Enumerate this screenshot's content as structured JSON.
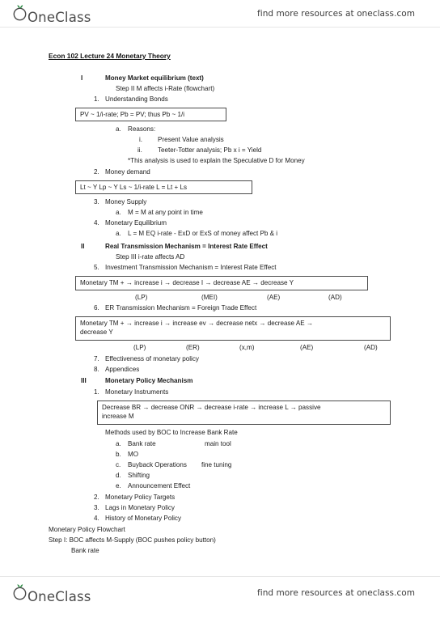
{
  "brand": {
    "logo_text": "OneClass",
    "logo_icon": "sprout-leaf-icon",
    "tagline": "find more resources at oneclass.com",
    "accent_color": "#2e8b46",
    "text_color": "#4a4a4a"
  },
  "document": {
    "title": "Econ 102 Lecture 24 Monetary Theory",
    "sections": [
      {
        "numeral": "I",
        "heading": "Money Market equilibrium (text)",
        "subtitle": "Step II M affects i-Rate (flowchart)",
        "items": [
          {
            "marker": "1.",
            "text": "Understanding Bonds"
          },
          {
            "marker": "a.",
            "text": "Reasons:"
          },
          {
            "marker": "i.",
            "text": "Present Value analysis"
          },
          {
            "marker": "ii.",
            "text": "Teeter-Totter analysis; Pb x i = Yield"
          },
          {
            "marker": "*",
            "text": "*This analysis is used to explain the Speculative D for Money"
          },
          {
            "marker": "2.",
            "text": "Money demand"
          },
          {
            "marker": "3.",
            "text": "Money Supply"
          },
          {
            "marker": "a.",
            "text": "M = M at any point in time"
          },
          {
            "marker": "4.",
            "text": "Monetary Equilibrium"
          },
          {
            "marker": "a.",
            "text": "L = M EQ i-rate - ExD or ExS of money affect Pb & i"
          }
        ]
      },
      {
        "numeral": "II",
        "heading": "Real Transmission Mechanism = Interest Rate Effect",
        "subtitle": "Step III i-rate affects AD",
        "items": [
          {
            "marker": "5.",
            "text": "Investment Transmission Mechanism = Interest Rate Effect"
          },
          {
            "marker": "6.",
            "text": "ER Transmission Mechanism = Foreign Trade Effect"
          },
          {
            "marker": "7.",
            "text": "Effectiveness of monetary policy"
          },
          {
            "marker": "8.",
            "text": "Appendices"
          }
        ]
      },
      {
        "numeral": "III",
        "heading": "Monetary Policy Mechanism",
        "subtitle": "",
        "items": [
          {
            "marker": "1.",
            "text": "Monetary Instruments"
          },
          {
            "marker": "",
            "text": "Methods used by BOC to Increase Bank Rate"
          },
          {
            "marker": "a.",
            "text": "Bank rate",
            "note": "main tool"
          },
          {
            "marker": "b.",
            "text": "MO",
            "note": ""
          },
          {
            "marker": "c.",
            "text": "Buyback Operations",
            "note": "fine tuning"
          },
          {
            "marker": "d.",
            "text": "Shifting",
            "note": ""
          },
          {
            "marker": "e.",
            "text": "Announcement Effect",
            "note": ""
          },
          {
            "marker": "2.",
            "text": "Monetary Policy Targets"
          },
          {
            "marker": "3.",
            "text": "Lags in Monetary Policy"
          },
          {
            "marker": "4.",
            "text": "History of Monetary Policy"
          }
        ]
      }
    ],
    "closing": [
      "Monetary Policy Flowchart",
      "Step I: BOC affects M-Supply (BOC pushes policy button)",
      "Bank rate"
    ],
    "boxes": [
      {
        "id": "bond-price-formula",
        "text": "PV ~ 1/i-rate; Pb = PV; thus Pb ~ 1/i"
      },
      {
        "id": "money-demand-formula",
        "text": "Lt ~ Y      Lp ~ Y      Ls ~ 1/i-rate      L = Lt + Ls"
      },
      {
        "id": "investment-transmission-chain",
        "text": "Monetary TM +  → increase i → decrease I → decrease AE → decrease Y"
      },
      {
        "id": "foreign-trade-transmission-chain",
        "line1": "Monetary TM +  → increase i → increase ev → decrease netx → decrease AE →",
        "line2": "decrease Y"
      },
      {
        "id": "bank-rate-chain",
        "line1": "Decrease BR → decrease ONR → decrease i-rate → increase L → passive",
        "line2": "increase M"
      }
    ],
    "annotation_rows": [
      {
        "id": "investment-chain-labels",
        "labels": [
          "(LP)",
          "(MEI)",
          "(AE)",
          "(AD)"
        ]
      },
      {
        "id": "foreign-trade-chain-labels",
        "labels": [
          "(LP)",
          "(ER)",
          "(x,m)",
          "(AE)",
          "(AD)"
        ]
      }
    ]
  }
}
